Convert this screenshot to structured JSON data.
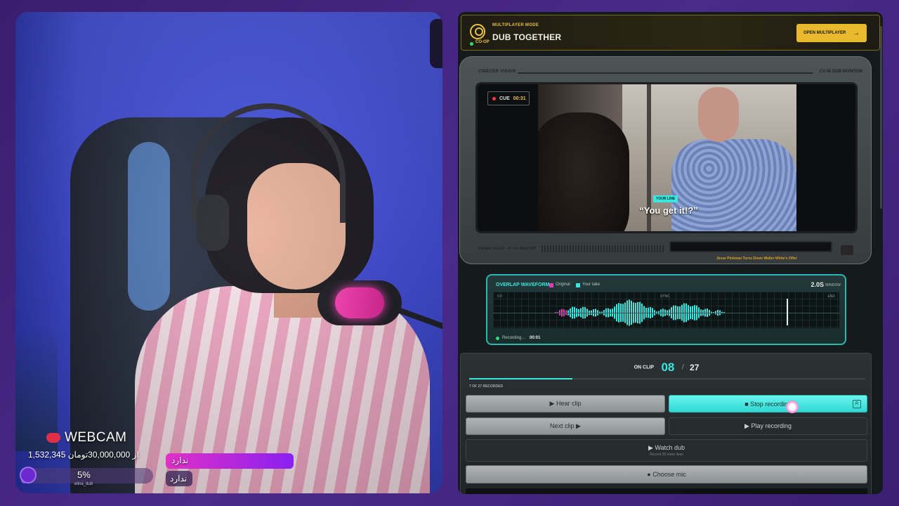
{
  "webcam": {
    "title": "WEBCAM",
    "donation_line": "1,532,345 از 30,000,000تومان",
    "progress_percent": 5,
    "progress_label": "5%",
    "progress_user": "elina_dub",
    "alert_primary": "ندارد",
    "alert_secondary": "ندارد"
  },
  "header": {
    "mode_label": "MULTIPLAYER MODE",
    "title": "DUB TOGETHER",
    "coop_label": "CO-OP",
    "button_label": "OPEN MULTIPLAYER",
    "accent": "#e8b92c"
  },
  "monitor": {
    "brand": "CINECER VISION",
    "model": "CV-4k DUB MONITOR",
    "cue_label": "CUE",
    "cue_time": "00:31",
    "your_line_label": "YOUR LINE",
    "subtitle": "“You get it!?”",
    "status_left": "FRAME HOLD · 97.3% MASTER",
    "credit": "Jesse Pinkman Turns Down Walter White's Offer"
  },
  "waveform": {
    "title": "OVERLAP WAVEFORM",
    "legend_original": "Original",
    "legend_take": "Your take",
    "window_value": "2.0S",
    "window_label": "WINDOW",
    "start_label": "0.0",
    "sync_label": "SYNC",
    "end_label": "END",
    "recording_label": "Recording…",
    "recording_time": "00:01",
    "colors": {
      "original": "#e03cb8",
      "take": "#39e6e0"
    }
  },
  "controls": {
    "on_clip_label": "ON CLIP",
    "current_clip": "08",
    "separator": "/",
    "total_clips": "27",
    "recorded_fraction": 0.26,
    "recorded_label": "7 OF 27 RECORDED",
    "hear_clip": "▶ Hear clip",
    "stop_recording": "■  Stop recording",
    "stop_key": "R",
    "next_clip": "Next clip ▶",
    "play_recording": "▶ Play recording",
    "watch_dub": "▶  Watch dub",
    "watch_dub_sub": "Record 20 more lines",
    "choose_mic": "● Choose mic"
  }
}
